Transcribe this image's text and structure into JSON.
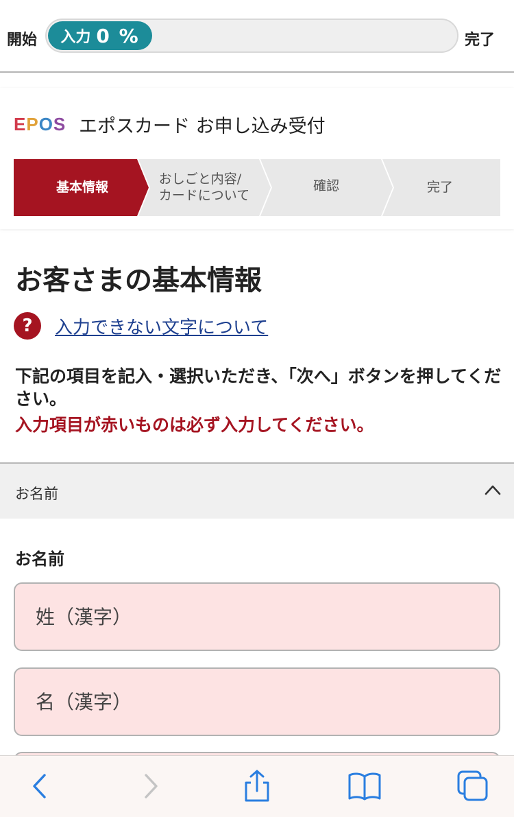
{
  "progress": {
    "start_label": "開始",
    "end_label": "完了",
    "fill_label": "入力",
    "percent_text": "0 %",
    "percent": 0,
    "color": "#1c8c99"
  },
  "header": {
    "logo_text": [
      "E",
      "P",
      "O",
      "S"
    ],
    "title": "エポスカード お申し込み受付"
  },
  "steps": [
    {
      "label": "基本情報",
      "active": true
    },
    {
      "label_lines": [
        "おしごと内容/",
        "カードについて"
      ],
      "active": false
    },
    {
      "label": "確認",
      "active": false
    },
    {
      "label": "完了",
      "active": false
    }
  ],
  "main": {
    "title": "お客さまの基本情報",
    "help_icon": "question-icon",
    "help_link": "入力できない文字について",
    "instruction": "下記の項目を記入・選択いただき、「次へ」ボタンを押してください。",
    "instruction_red": "入力項目が赤いものは必ず入力してください。"
  },
  "section": {
    "title": "お名前",
    "toggle_icon": "chevron-up-icon"
  },
  "form": {
    "field_label": "お名前",
    "last_name_placeholder": "姓（漢字）",
    "first_name_placeholder": "名（漢字）",
    "third_placeholder": ""
  },
  "toolbar": {
    "icons": [
      "back-icon",
      "forward-icon",
      "share-icon",
      "bookmarks-icon",
      "tabs-icon"
    ]
  },
  "colors": {
    "accent_red": "#a51421",
    "link_blue": "#1d3f8f",
    "required_field_bg": "#fde3e3",
    "toolbar_blue": "#2a7ee0"
  }
}
